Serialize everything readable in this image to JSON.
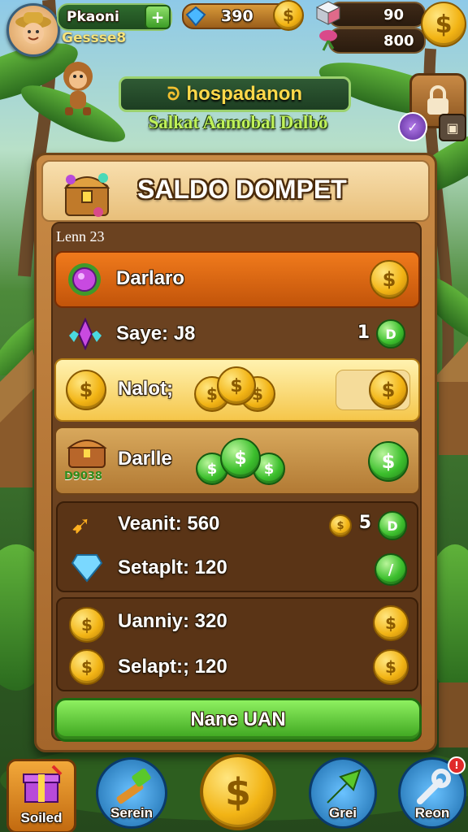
{
  "player": {
    "name": "Pkaoni",
    "id_code": "Gessse8",
    "add_icon": "plus-icon"
  },
  "currency": {
    "gems_value": "390",
    "top_right_value": "90",
    "lower_right_value": "800"
  },
  "banner": {
    "title": "hospadanon",
    "subtitle": "Salkat Aamobal Dalbö"
  },
  "panel": {
    "title": "SALDO DOMPET",
    "subheader": "Lenn 23",
    "rows": [
      {
        "label": "Darlaro",
        "icon": "gem-flower-icon"
      },
      {
        "label": "Saye: J8",
        "right_value": "1",
        "right_badge": "D"
      },
      {
        "label": "Nalot;"
      },
      {
        "label": "Darlle",
        "sub_label": "D9038"
      }
    ],
    "stats_group1": [
      {
        "label": "Veanit: 560",
        "right_value": "5",
        "right_badge": "D"
      },
      {
        "label": "Setaplt: 120"
      }
    ],
    "stats_group2": [
      {
        "label": "Uanniy: 320"
      },
      {
        "label": "Selapt:; 120"
      }
    ],
    "action_button": "Nane UAN"
  },
  "bottom_nav": [
    {
      "label": "Soiled",
      "icon": "gift-box-icon"
    },
    {
      "label": "Serein",
      "icon": "hammer-icon"
    },
    {
      "label": "",
      "icon": "dollar-coin-icon"
    },
    {
      "label": "Grei",
      "icon": "arrow-icon"
    },
    {
      "label": "Reon",
      "icon": "wrench-icon"
    }
  ],
  "colors": {
    "panel_wood": "#c98a45",
    "orange_row": "#e06a12",
    "yellow_row": "#ffd76a",
    "green_button": "#4cc22e"
  }
}
